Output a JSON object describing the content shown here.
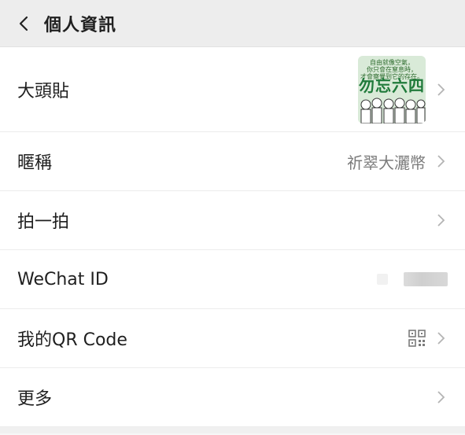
{
  "header": {
    "title": "個人資訊"
  },
  "rows": {
    "avatar": {
      "label": "大頭貼",
      "tile_text_1": "自由就像空氣，",
      "tile_text_2": "你只會在窒息時，",
      "tile_text_3": "才會察覺到它的存在。",
      "tile_slogan": "勿忘六四"
    },
    "nickname": {
      "label": "暱稱",
      "value": "祈翠大灑幣"
    },
    "pat": {
      "label": "拍一拍"
    },
    "wechat_id": {
      "label": "WeChat ID"
    },
    "qr": {
      "label": "我的QR Code"
    },
    "more": {
      "label": "更多"
    }
  },
  "colors": {
    "header_bg": "#ededed",
    "row_bg": "#ffffff",
    "value_text": "#7b7b7b",
    "slogan_green": "#1f7a3a"
  },
  "icons": {
    "back": "chevron-left-icon",
    "chevron": "chevron-right-icon",
    "qr": "qr-code-icon"
  }
}
